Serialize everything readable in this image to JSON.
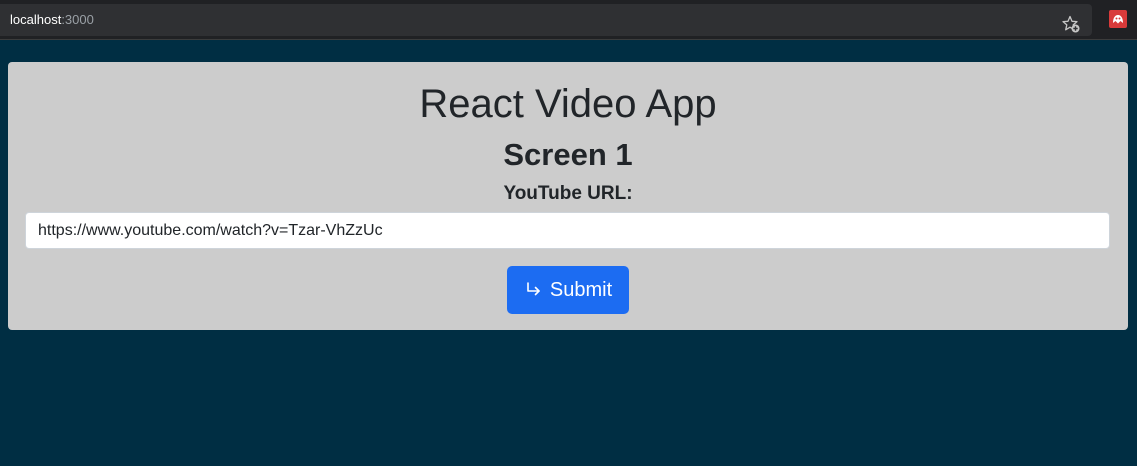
{
  "browser": {
    "url_host": "localhost",
    "url_port": ":3000",
    "icons": [
      "bookmark-star-icon",
      "extension-icon"
    ]
  },
  "app": {
    "title": "React Video App",
    "screen_title": "Screen 1",
    "url_label": "YouTube URL:",
    "url_value": "https://www.youtube.com/watch?v=Tzar-VhZzUc",
    "submit_label": "Submit",
    "submit_icon": "arrow-return-right-icon"
  },
  "colors": {
    "background": "#002e43",
    "card": "#cccccc",
    "primary_button": "#1c6cf2"
  }
}
